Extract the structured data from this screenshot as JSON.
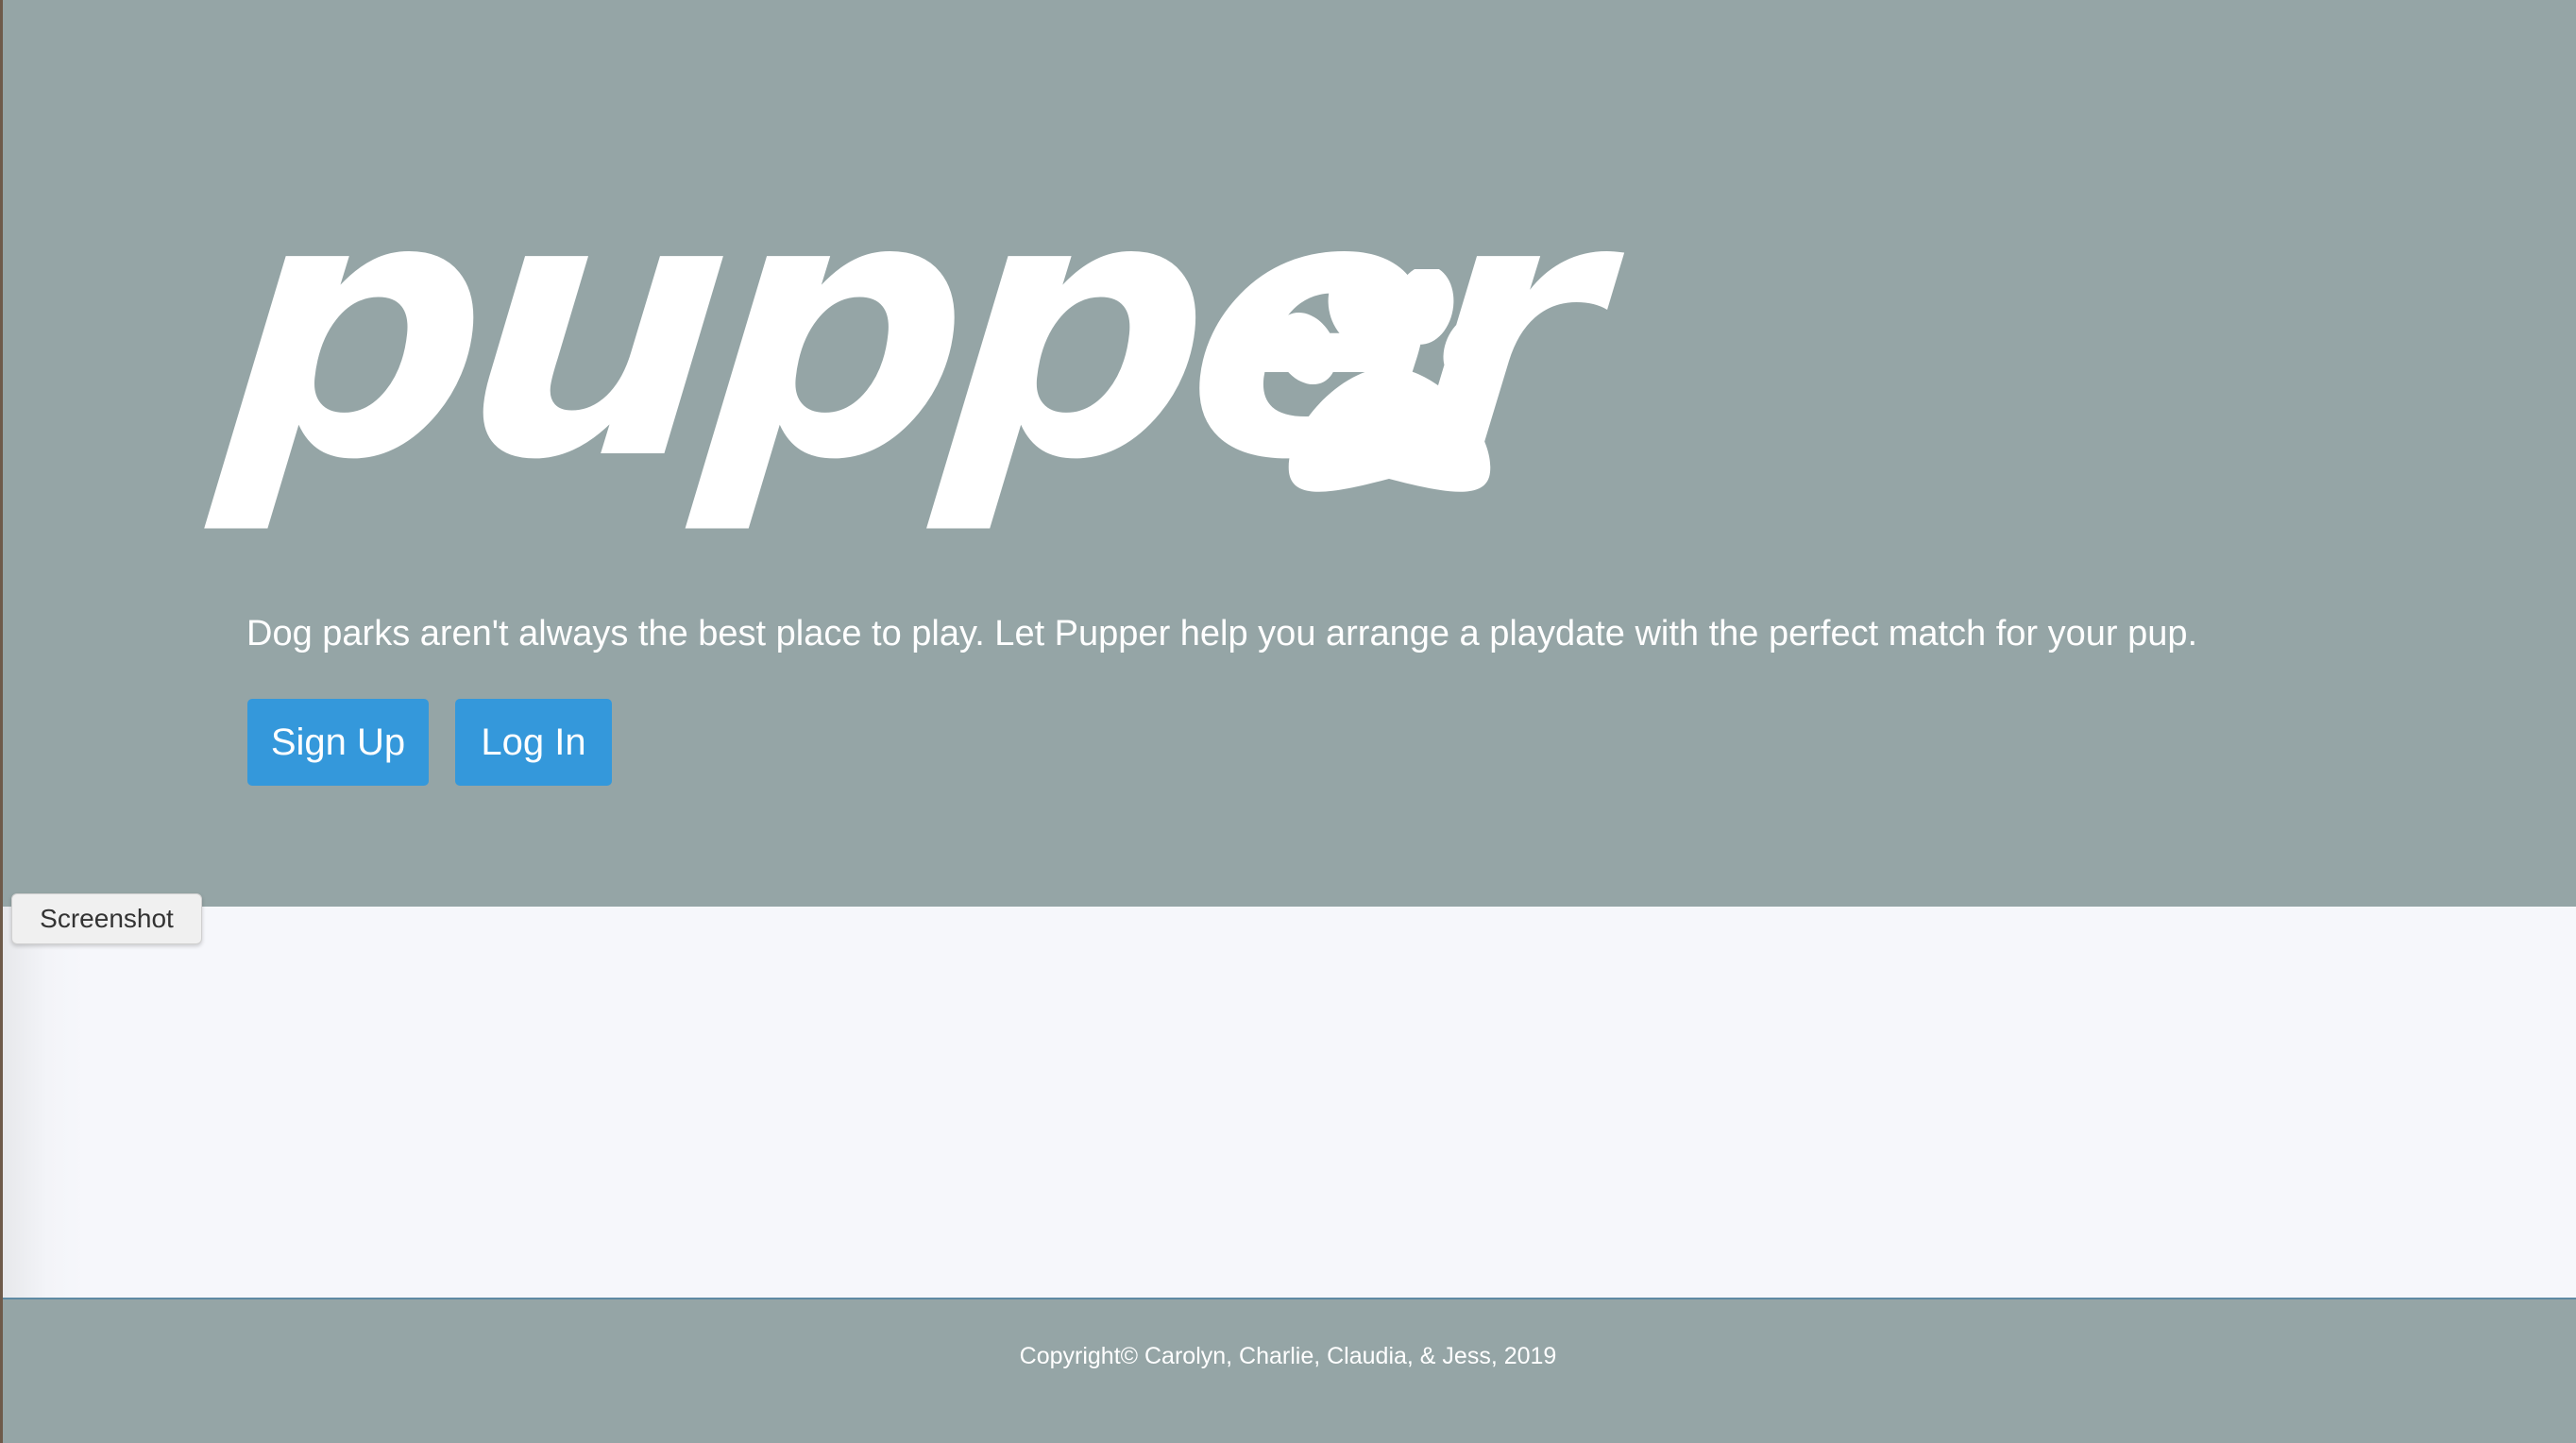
{
  "hero": {
    "logo_text": "pupper",
    "logo_icon": "paw-icon",
    "tagline": "Dog parks aren't always the best place to play. Let Pupper help you arrange a playdate with the perfect match for your pup.",
    "background_color": "#95a5a6"
  },
  "buttons": {
    "signup_label": "Sign Up",
    "login_label": "Log In",
    "color": "#3498db"
  },
  "overlay": {
    "screenshot_label": "Screenshot"
  },
  "footer": {
    "copyright": "Copyright©  Carolyn, Charlie, Claudia, & Jess, 2019"
  }
}
